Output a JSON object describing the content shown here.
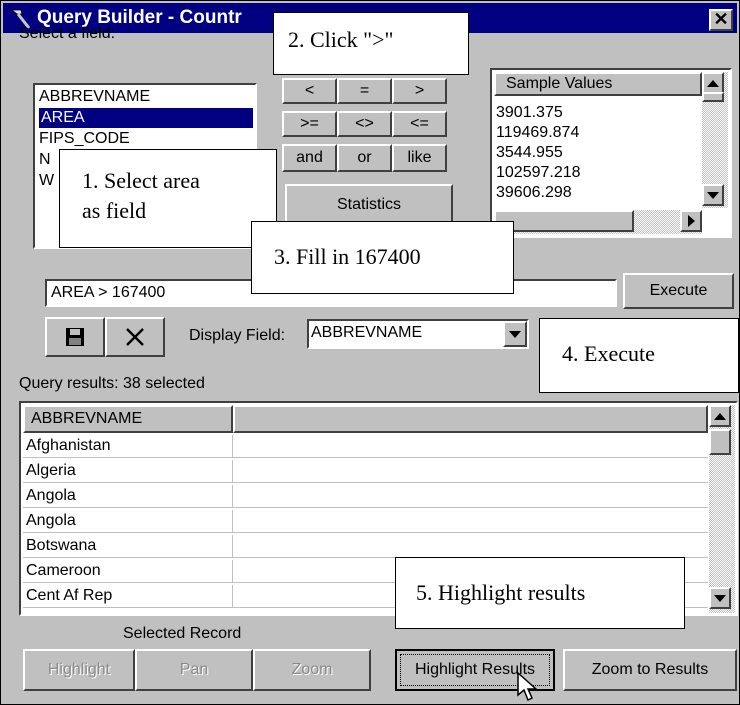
{
  "window": {
    "title": "Query Builder - Countr",
    "close_glyph": "✕"
  },
  "select_field": {
    "label": "Select a field:",
    "items": [
      "ABBREVNAME",
      "AREA",
      "FIPS_CODE",
      "N",
      "W"
    ],
    "selected": "AREA"
  },
  "operators": [
    "<",
    "=",
    ">",
    ">=",
    "<>",
    "<=",
    "and",
    "or",
    "like"
  ],
  "statistics_button": "Statistics",
  "sample_values": {
    "header": "Sample Values",
    "values": [
      "3901.375",
      "119469.874",
      "3544.955",
      "102597.218",
      "39606.298"
    ]
  },
  "query": {
    "expression": "AREA > 167400",
    "execute_label": "Execute"
  },
  "toolbar": {
    "save_icon": "floppy-disk-icon",
    "clear_icon": "x-icon",
    "display_field_label": "Display Field:",
    "display_field_value": "ABBREVNAME"
  },
  "results": {
    "summary": "Query results: 38 selected",
    "column_header": "ABBREVNAME",
    "rows": [
      "Afghanistan",
      "Algeria",
      "Angola",
      "Angola",
      "Botswana",
      "Cameroon",
      "Cent Af Rep"
    ]
  },
  "selected_record": {
    "label": "Selected Record",
    "highlight": "Highlight",
    "pan": "Pan",
    "zoom": "Zoom"
  },
  "result_actions": {
    "highlight_results": "Highlight Results",
    "zoom_to_results": "Zoom to Results"
  },
  "callouts": {
    "step1_line1": "1. Select area",
    "step1_line2": "as field",
    "step2": "2. Click \">\"",
    "step3": "3. Fill in 167400",
    "step4": "4. Execute",
    "step5": "5. Highlight results"
  }
}
